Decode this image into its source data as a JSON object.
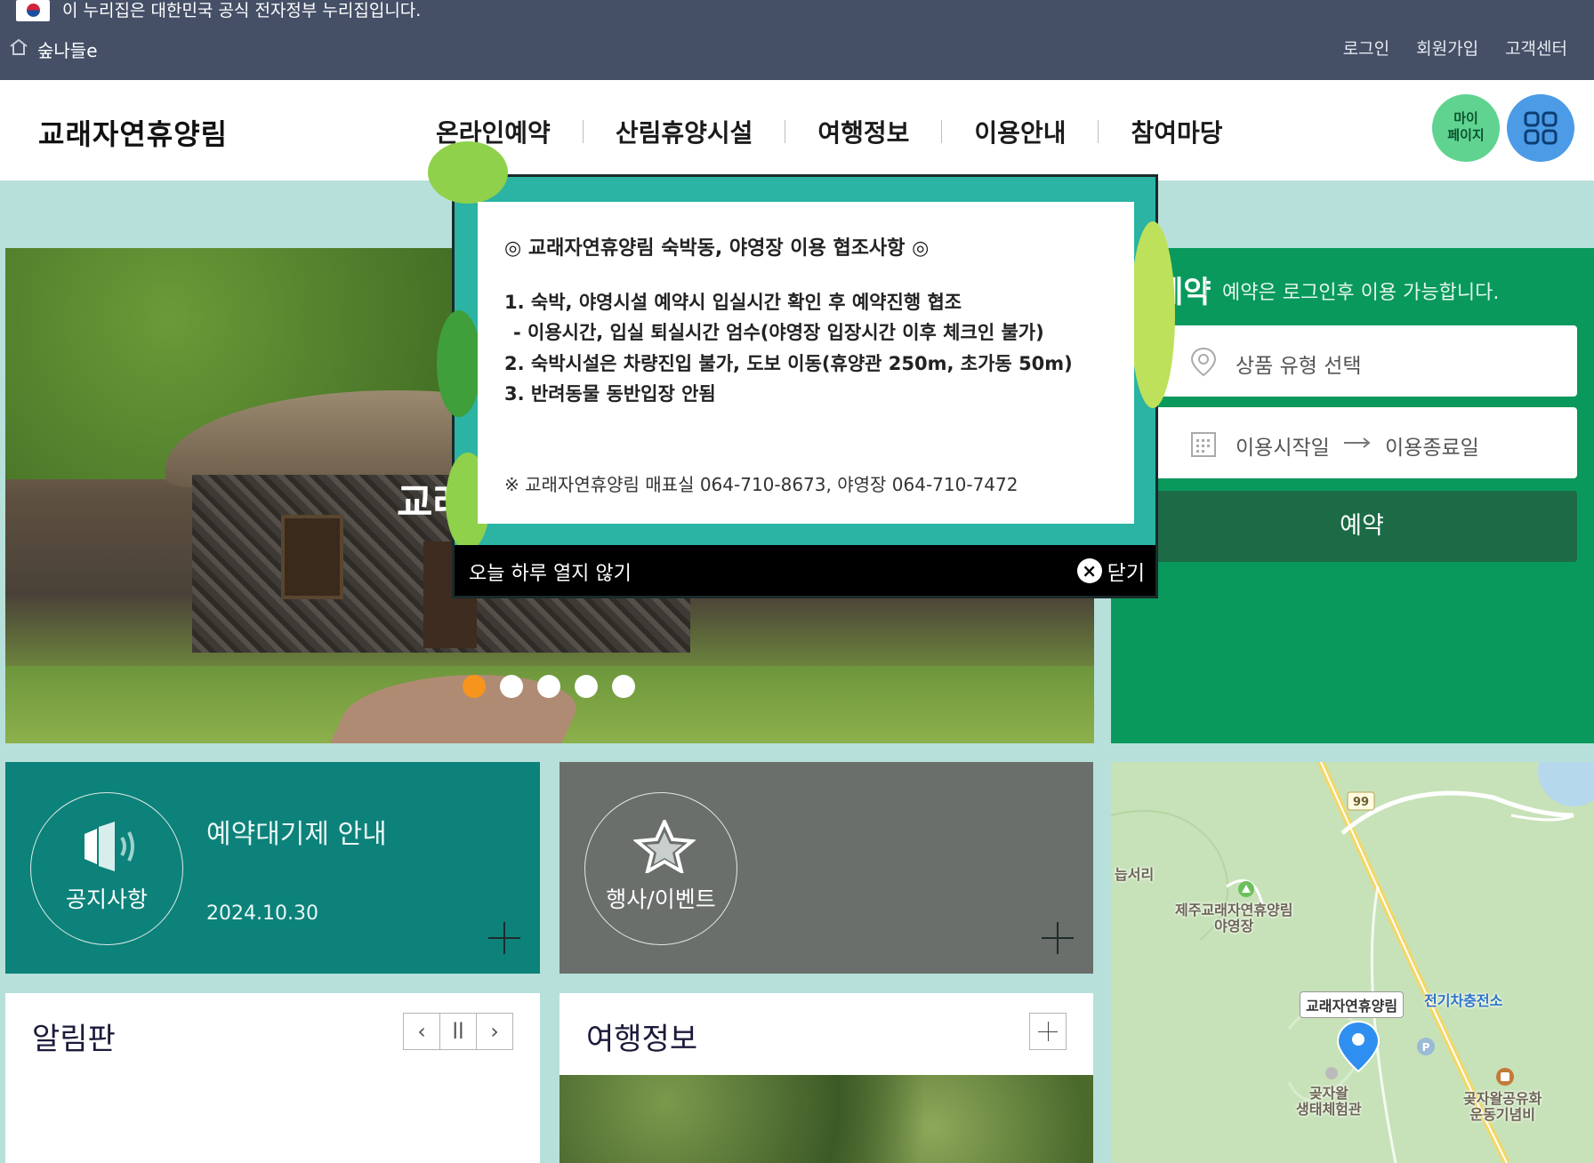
{
  "gov_banner": {
    "text": "이 누리집은 대한민국 공식 전자정부 누리집입니다.",
    "site_name": "숲나들e",
    "util": [
      "로그인",
      "회원가입",
      "고객센터"
    ]
  },
  "header": {
    "logo": "교래자연휴양림",
    "nav": [
      "온라인예약",
      "산림휴양시설",
      "여행정보",
      "이용안내",
      "참여마당"
    ],
    "mypage_label_1": "마이",
    "mypage_label_2": "페이지"
  },
  "hero": {
    "caption": "교래",
    "slide_count": 5,
    "active_slide": 1
  },
  "reservation": {
    "title": "예약",
    "note": "예약은 로그인후 이용 가능합니다.",
    "product_placeholder": "상품 유형 선택",
    "start_date": "이용시작일",
    "end_date": "이용종료일",
    "submit_label": "예약"
  },
  "tiles": {
    "notice": {
      "label": "공지사항",
      "title": "예약대기제 안내",
      "date": "2024.10.30"
    },
    "event": {
      "label": "행사/이벤트"
    }
  },
  "board": {
    "title": "알림판",
    "prev": "‹",
    "pause": "ll",
    "next": "›"
  },
  "travel": {
    "title": "여행정보"
  },
  "map": {
    "road_number": "99",
    "labels": {
      "area": "늡서리",
      "camp_1": "제주교래자연휴양림",
      "camp_2": "야영장",
      "poi": "교래자연휴양림",
      "charger": "전기차충전소",
      "eco_1": "곶자왈",
      "eco_2": "생태체험관",
      "memorial_1": "곶자왈공유화",
      "memorial_2": "운동기념비"
    }
  },
  "popup": {
    "title": "◎ 교래자연휴양림 숙박동, 야영장 이용 협조사항 ◎",
    "line1": "1. 숙박, 야영시설 예약시 입실시간 확인 후 예약진행 협조",
    "line1_sub": "- 이용시간, 입실 퇴실시간 엄수(야영장 입장시간 이후 체크인 불가)",
    "line2": "2. 숙박시설은 차량진입 불가, 도보 이동(휴양관 250m, 초가동 50m)",
    "line3": "3. 반려동물 동반입장 안됨",
    "contact": "※ 교래자연휴양림 매표실 064-710-8673, 야영장 064-710-7472",
    "dont_show_today": "오늘 하루 열지 않기",
    "close_label": "닫기",
    "close_icon": "×"
  },
  "colors": {
    "gov_bg": "#455067",
    "reservation_bg": "#09995c",
    "notice_bg": "#0c827a",
    "event_bg": "#6a6f6c",
    "popup_bg": "#2bb3a3",
    "active_dot": "#f7941d"
  }
}
